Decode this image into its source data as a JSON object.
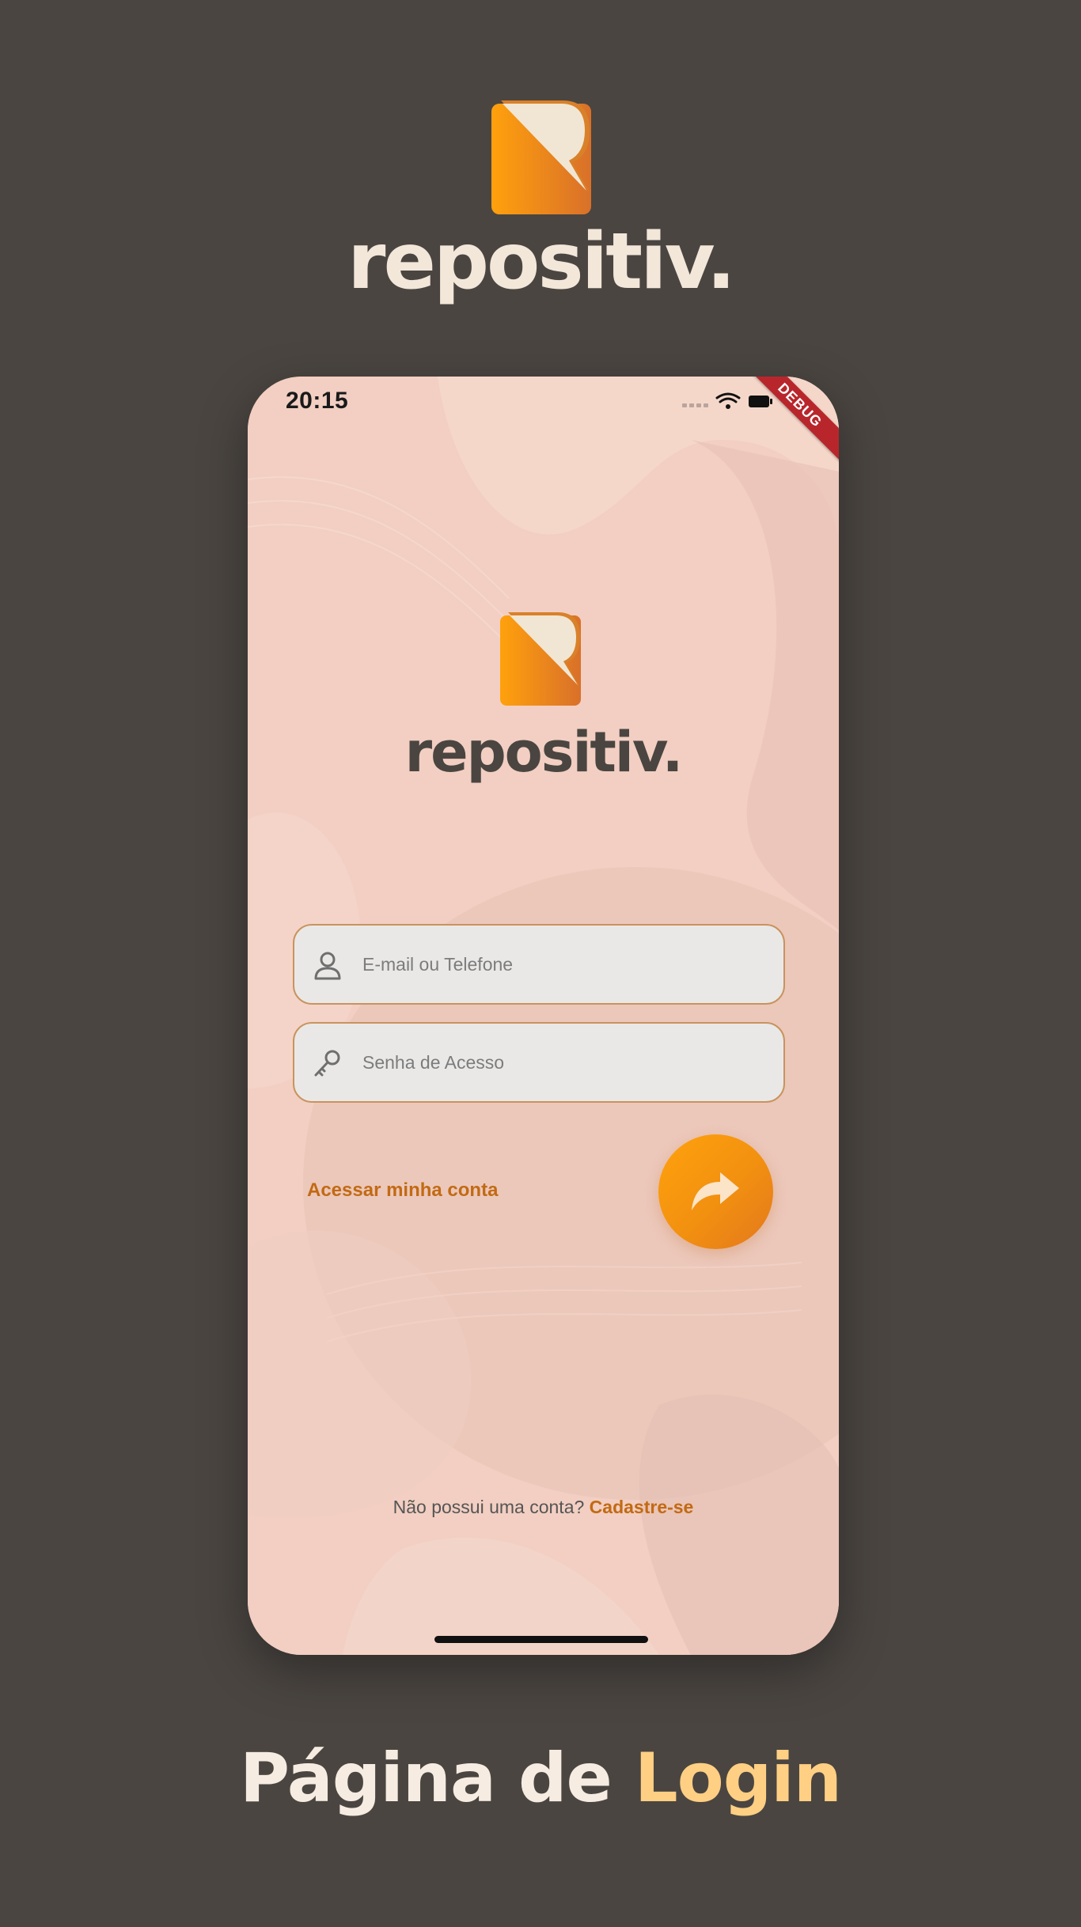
{
  "brand": {
    "name": "repositiv."
  },
  "status_bar": {
    "time": "20:15",
    "debug_label": "DEBUG"
  },
  "login_form": {
    "email_placeholder": "E-mail ou Telefone",
    "password_placeholder": "Senha de Acesso",
    "submit_label": "Acessar minha conta"
  },
  "signup": {
    "prompt": "Não possui uma conta?",
    "link": "Cadastre-se"
  },
  "caption": {
    "prefix": "Página de",
    "highlight": "Login"
  },
  "icons": {
    "email_field": "user-icon",
    "password_field": "key-icon",
    "submit_button": "share-arrow-icon",
    "status": [
      "signal-icon",
      "wifi-icon",
      "battery-icon"
    ]
  },
  "colors": {
    "background": "#4a4541",
    "phone_background": "#f0cbbf",
    "accent_orange": "#f29010",
    "link_color": "#c26a13",
    "caption_highlight": "#ffcf83"
  }
}
